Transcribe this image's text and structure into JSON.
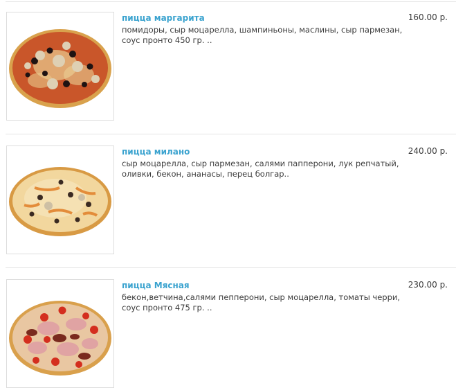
{
  "products": [
    {
      "name": "пицца маргарита",
      "description": "помидоры, сыр моцарелла, шампиньоны, маслины, сыр пармезан, соус пронто 450 гр. ..",
      "price": "160.00 р."
    },
    {
      "name": "пицца милано",
      "description": "сыр моцарелла, сыр пармезан, салями папперони, лук репчатый, оливки, бекон, ананасы, перец болгар..",
      "price": "240.00 р."
    },
    {
      "name": "пицца Мясная",
      "description": "бекон,ветчина,салями пепперони, сыр моцарелла, томаты черри, соус пронто 475 гр. ..",
      "price": "230.00 р."
    }
  ],
  "colors": {
    "product_link": "#3ba3cf",
    "text": "#3a3a3a",
    "divider": "#e4e4e4"
  },
  "icons": [
    "pizza-margarita-image",
    "pizza-milano-image",
    "pizza-meat-image"
  ]
}
